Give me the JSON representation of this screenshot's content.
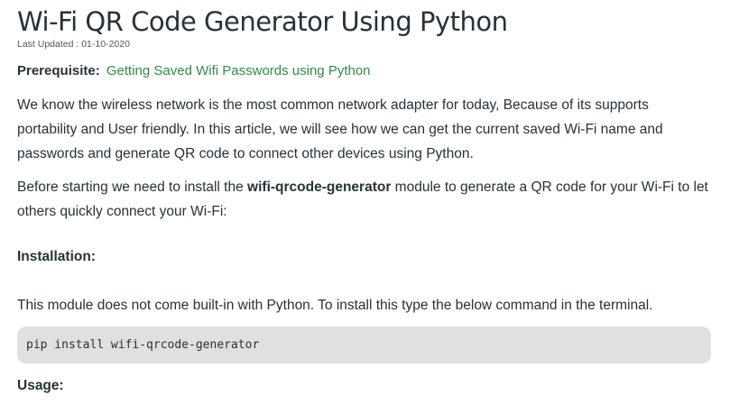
{
  "article": {
    "title": "Wi-Fi QR Code Generator Using Python",
    "last_updated_label": "Last Updated :",
    "last_updated_date": "01-10-2020",
    "prerequisite_label": "Prerequisite:",
    "prerequisite_link": "Getting Saved Wifi Passwords using Python",
    "paragraph1": "We know the wireless network is the most common network adapter for today, Because of its supports portability and User friendly. In this article, we will see how we can get the current saved Wi-Fi name and passwords and generate QR code to connect other devices using Python.",
    "paragraph2_before": "Before starting we need to install the ",
    "paragraph2_module": "wifi-qrcode-generator",
    "paragraph2_after": " module to generate a QR code for your Wi-Fi to let others quickly connect your Wi-Fi:",
    "installation_heading": "Installation:",
    "installation_text": "This module does not come built-in with Python. To install this type the below command in the terminal.",
    "install_command": "pip install wifi-qrcode-generator",
    "usage_heading": "Usage:"
  }
}
